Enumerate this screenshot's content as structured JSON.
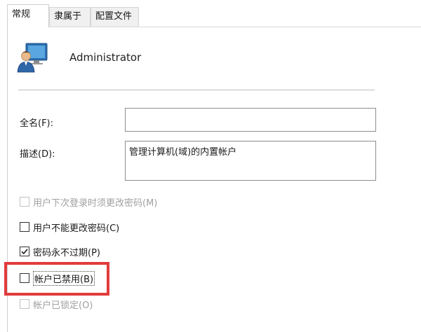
{
  "tabs": [
    {
      "label": "常规",
      "active": true
    },
    {
      "label": "隶属于",
      "active": false
    },
    {
      "label": "配置文件",
      "active": false
    }
  ],
  "user": {
    "name": "Administrator",
    "icon": "user-account-icon"
  },
  "fields": {
    "fullname_label": "全名(F):",
    "fullname_value": "",
    "desc_label": "描述(D):",
    "desc_value": "管理计算机(域)的内置帐户"
  },
  "checkboxes": [
    {
      "label": "用户下次登录时须更改密码(M)",
      "checked": false,
      "enabled": false
    },
    {
      "label": "用户不能更改密码(C)",
      "checked": false,
      "enabled": true
    },
    {
      "label": "密码永不过期(P)",
      "checked": true,
      "enabled": true
    },
    {
      "label": "帐户已禁用(B)",
      "checked": false,
      "enabled": true
    },
    {
      "label": "帐户已锁定(O)",
      "checked": false,
      "enabled": false
    }
  ],
  "colors": {
    "highlight": "#e23b3b",
    "tab_inactive_bg": "#f0f0f0"
  }
}
